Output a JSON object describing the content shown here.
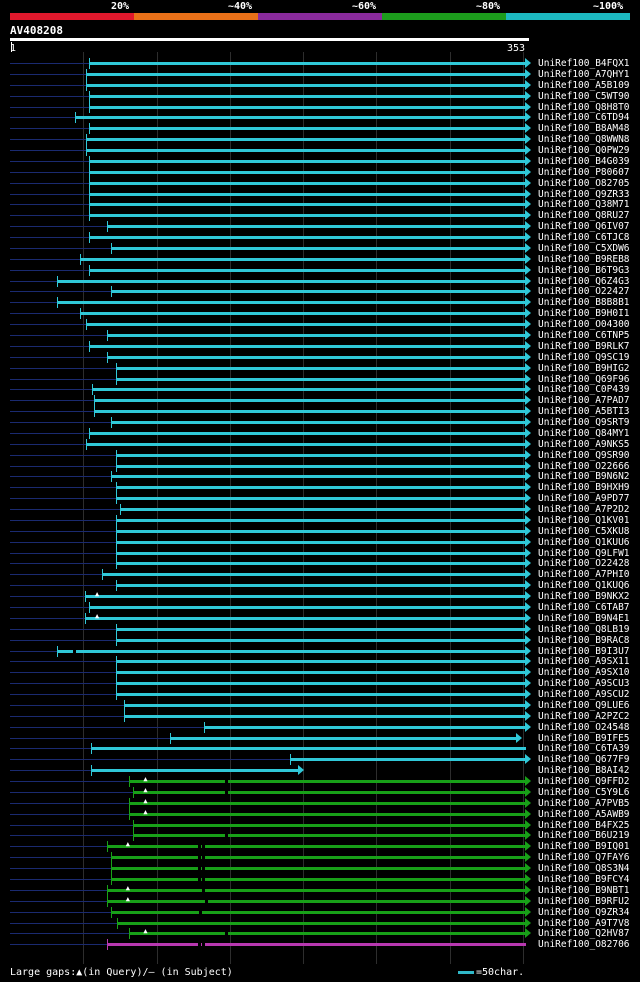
{
  "legend": {
    "segments": [
      {
        "label": "20%",
        "color": "#e0182c"
      },
      {
        "label": "~40%",
        "color": "#e87018"
      },
      {
        "label": "~60%",
        "color": "#8a2a9c"
      },
      {
        "label": "~80%",
        "color": "#1c9c1c"
      },
      {
        "label": "~100%",
        "color": "#1cb8c0"
      }
    ]
  },
  "query": {
    "id": "AV408208",
    "start": "1",
    "end": "353",
    "length": 353
  },
  "colors": {
    "cyan": "#30c8d8",
    "green": "#18a018",
    "magenta": "#b838b0",
    "missing": "#1a2a70"
  },
  "hits": [
    {
      "name": "UniRef100_B4FQX1",
      "start": 55,
      "color": "cyan"
    },
    {
      "name": "UniRef100_A7QHY1",
      "start": 53,
      "color": "cyan"
    },
    {
      "name": "UniRef100_A5B109",
      "start": 53,
      "color": "cyan"
    },
    {
      "name": "UniRef100_C5WT90",
      "start": 55,
      "color": "cyan"
    },
    {
      "name": "UniRef100_Q8H8T0",
      "start": 55,
      "color": "cyan"
    },
    {
      "name": "UniRef100_C6TD94",
      "start": 45,
      "color": "cyan"
    },
    {
      "name": "UniRef100_B8AM48",
      "start": 55,
      "color": "cyan"
    },
    {
      "name": "UniRef100_Q8WWN8",
      "start": 53,
      "color": "cyan"
    },
    {
      "name": "UniRef100_Q0PW29",
      "start": 53,
      "color": "cyan"
    },
    {
      "name": "UniRef100_B4G039",
      "start": 55,
      "color": "cyan"
    },
    {
      "name": "UniRef100_P80607",
      "start": 55,
      "color": "cyan"
    },
    {
      "name": "UniRef100_O82705",
      "start": 55,
      "color": "cyan"
    },
    {
      "name": "UniRef100_Q9ZR33",
      "start": 55,
      "color": "cyan"
    },
    {
      "name": "UniRef100_Q38M71",
      "start": 55,
      "color": "cyan"
    },
    {
      "name": "UniRef100_Q8RU27",
      "start": 55,
      "color": "cyan"
    },
    {
      "name": "UniRef100_Q6IV07",
      "start": 67,
      "color": "cyan"
    },
    {
      "name": "UniRef100_C6TJC8",
      "start": 55,
      "color": "cyan"
    },
    {
      "name": "UniRef100_C5XDW6",
      "start": 70,
      "color": "cyan"
    },
    {
      "name": "UniRef100_B9REB8",
      "start": 49,
      "color": "cyan"
    },
    {
      "name": "UniRef100_B6T9G3",
      "start": 55,
      "color": "cyan"
    },
    {
      "name": "UniRef100_Q6Z4G3",
      "start": 33,
      "color": "cyan"
    },
    {
      "name": "UniRef100_O22427",
      "start": 70,
      "color": "cyan"
    },
    {
      "name": "UniRef100_B8B8B1",
      "start": 33,
      "color": "cyan"
    },
    {
      "name": "UniRef100_B9H0I1",
      "start": 49,
      "color": "cyan"
    },
    {
      "name": "UniRef100_O04300",
      "start": 53,
      "color": "cyan"
    },
    {
      "name": "UniRef100_C6TNP5",
      "start": 67,
      "color": "cyan"
    },
    {
      "name": "UniRef100_B9RLK7",
      "start": 55,
      "color": "cyan"
    },
    {
      "name": "UniRef100_Q9SC19",
      "start": 67,
      "color": "cyan"
    },
    {
      "name": "UniRef100_B9HIG2",
      "start": 73,
      "color": "cyan"
    },
    {
      "name": "UniRef100_Q69F96",
      "start": 73,
      "color": "cyan"
    },
    {
      "name": "UniRef100_C0P439",
      "start": 57,
      "color": "cyan"
    },
    {
      "name": "UniRef100_A7PAD7",
      "start": 58,
      "color": "cyan"
    },
    {
      "name": "UniRef100_A5BTI3",
      "start": 58,
      "color": "cyan"
    },
    {
      "name": "UniRef100_Q9SRT9",
      "start": 70,
      "color": "cyan"
    },
    {
      "name": "UniRef100_Q84MY1",
      "start": 55,
      "color": "cyan"
    },
    {
      "name": "UniRef100_A9NKS5",
      "start": 53,
      "color": "cyan"
    },
    {
      "name": "UniRef100_Q9SR90",
      "start": 73,
      "color": "cyan"
    },
    {
      "name": "UniRef100_O22666",
      "start": 73,
      "color": "cyan"
    },
    {
      "name": "UniRef100_B9N6N2",
      "start": 70,
      "color": "cyan"
    },
    {
      "name": "UniRef100_B9HXH9",
      "start": 73,
      "color": "cyan"
    },
    {
      "name": "UniRef100_A9PD77",
      "start": 73,
      "color": "cyan"
    },
    {
      "name": "UniRef100_A7P2D2",
      "start": 76,
      "color": "cyan"
    },
    {
      "name": "UniRef100_Q1KV01",
      "start": 73,
      "color": "cyan"
    },
    {
      "name": "UniRef100_C5XKU8",
      "start": 73,
      "color": "cyan"
    },
    {
      "name": "UniRef100_Q1KUU6",
      "start": 73,
      "color": "cyan"
    },
    {
      "name": "UniRef100_Q9LFW1",
      "start": 73,
      "color": "cyan"
    },
    {
      "name": "UniRef100_O22428",
      "start": 73,
      "color": "cyan"
    },
    {
      "name": "UniRef100_A7PHI0",
      "start": 64,
      "color": "cyan"
    },
    {
      "name": "UniRef100_Q1KUQ6",
      "start": 73,
      "color": "cyan"
    },
    {
      "name": "UniRef100_B9NKX2",
      "start": 52,
      "color": "cyan",
      "gapq": [
        61
      ]
    },
    {
      "name": "UniRef100_C6TAB7",
      "start": 55,
      "color": "cyan"
    },
    {
      "name": "UniRef100_B9N4E1",
      "start": 52,
      "color": "cyan",
      "gapq": [
        61
      ]
    },
    {
      "name": "UniRef100_Q8LB19",
      "start": 73,
      "color": "cyan"
    },
    {
      "name": "UniRef100_B9RAC8",
      "start": 73,
      "color": "cyan"
    },
    {
      "name": "UniRef100_B9I3U7",
      "start": 33,
      "color": "cyan",
      "gaps": [
        44
      ]
    },
    {
      "name": "UniRef100_A9SX11",
      "start": 73,
      "color": "cyan"
    },
    {
      "name": "UniRef100_A9SX10",
      "start": 73,
      "color": "cyan"
    },
    {
      "name": "UniRef100_A9SCU3",
      "start": 73,
      "color": "cyan"
    },
    {
      "name": "UniRef100_A9SCU2",
      "start": 73,
      "color": "cyan"
    },
    {
      "name": "UniRef100_Q9LUE6",
      "start": 79,
      "color": "cyan"
    },
    {
      "name": "UniRef100_A2PZC2",
      "start": 79,
      "color": "cyan"
    },
    {
      "name": "UniRef100_O24548",
      "start": 133,
      "color": "cyan"
    },
    {
      "name": "UniRef100_B9IFE5",
      "start": 110,
      "end": 347,
      "color": "cyan",
      "left_tick": true
    },
    {
      "name": "UniRef100_C6TA39",
      "start": 56,
      "end": 353,
      "color": "cyan",
      "noarrow": true
    },
    {
      "name": "UniRef100_Q677F9",
      "start": 192,
      "color": "cyan",
      "left_tick": true
    },
    {
      "name": "UniRef100_B8AI42",
      "start": 56,
      "end": 198,
      "color": "cyan"
    },
    {
      "name": "UniRef100_Q9FFD2",
      "start": 82,
      "color": "green",
      "gapq": [
        94
      ],
      "gaps": [
        148
      ]
    },
    {
      "name": "UniRef100_C5Y9L6",
      "start": 85,
      "color": "green",
      "gapq": [
        94
      ],
      "gaps": [
        148
      ]
    },
    {
      "name": "UniRef100_A7PVB5",
      "start": 82,
      "color": "green",
      "gapq": [
        94
      ]
    },
    {
      "name": "UniRef100_A5AWB9",
      "start": 82,
      "color": "green",
      "gapq": [
        94
      ]
    },
    {
      "name": "UniRef100_B4FX25",
      "start": 85,
      "color": "green"
    },
    {
      "name": "UniRef100_B6U219",
      "start": 85,
      "color": "green",
      "gaps": [
        148
      ]
    },
    {
      "name": "UniRef100_B9IQ01",
      "start": 67,
      "color": "green",
      "gapq": [
        82
      ],
      "gaps": [
        129,
        132
      ]
    },
    {
      "name": "UniRef100_Q7FAY6",
      "start": 70,
      "color": "green",
      "gaps": [
        129,
        132
      ]
    },
    {
      "name": "UniRef100_Q8S3N4",
      "start": 70,
      "color": "green",
      "gaps": [
        129,
        132
      ]
    },
    {
      "name": "UniRef100_B9FCY4",
      "start": 70,
      "color": "green",
      "gaps": [
        129,
        132
      ]
    },
    {
      "name": "UniRef100_B9NBT1",
      "start": 67,
      "color": "green",
      "gapq": [
        82
      ],
      "gaps": [
        132
      ]
    },
    {
      "name": "UniRef100_B9RFU2",
      "start": 67,
      "color": "green",
      "gapq": [
        82
      ],
      "gaps": [
        134
      ]
    },
    {
      "name": "UniRef100_Q9ZR34",
      "start": 70,
      "color": "green",
      "gaps": [
        130
      ]
    },
    {
      "name": "UniRef100_A9T7V8",
      "start": 74,
      "color": "green"
    },
    {
      "name": "UniRef100_Q2HV87",
      "start": 82,
      "color": "green",
      "gapq": [
        94
      ],
      "gaps": [
        148
      ]
    },
    {
      "name": "UniRef100_O82706",
      "start": 67,
      "color": "magenta",
      "noarrow": true,
      "gaps": [
        129,
        132
      ]
    }
  ],
  "footer": {
    "large_gaps": "Large gaps:",
    "in_query_sym": "▲",
    "in_query": "(in Query)/",
    "in_subject_sym": "–",
    "in_subject": " (in Subject)"
  },
  "scale_key": {
    "label": "=50char."
  }
}
